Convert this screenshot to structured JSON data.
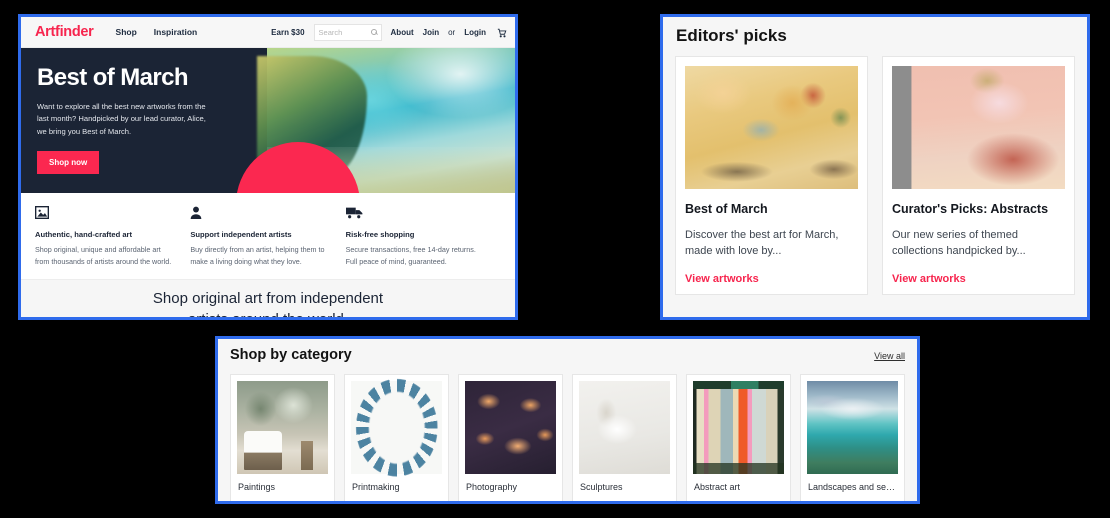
{
  "theme": {
    "accent_red": "#f7254e",
    "hero_bg": "#1b2435",
    "panel_border_blue": "#2f6bec",
    "page_bg": "#000000"
  },
  "homepage": {
    "header": {
      "brand": "Artfinder",
      "nav": [
        {
          "label": "Shop",
          "name": "nav-shop"
        },
        {
          "label": "Inspiration",
          "name": "nav-inspiration"
        }
      ],
      "earn_label": "Earn $30",
      "search_placeholder": "Search",
      "search_value": "",
      "about_label": "About",
      "join_label": "Join",
      "or_label": "or",
      "login_label": "Login",
      "cart_icon": "shopping-cart-icon",
      "search_icon": "search-icon"
    },
    "hero": {
      "title": "Best of March",
      "subtitle": "Want to explore all the best new artworks from the last month? Handpicked by our lead curator, Alice, we bring you Best of March.",
      "cta_label": "Shop now"
    },
    "features": [
      {
        "icon": "image-icon",
        "title": "Authentic, hand-crafted art",
        "text": "Shop original, unique and affordable art from thousands of artists around the world."
      },
      {
        "icon": "person-icon",
        "title": "Support independent artists",
        "text": "Buy directly from an artist, helping them to make a living doing what they love."
      },
      {
        "icon": "truck-icon",
        "title": "Risk-free shopping",
        "text": "Secure transactions, free 14-day returns. Full peace of mind, guaranteed."
      }
    ],
    "tagline": "Shop original art from independent artists around the world."
  },
  "editors_picks": {
    "title": "Editors' picks",
    "cards": [
      {
        "image": "best-of-march-artwork",
        "name": "Best of March",
        "description": "Discover the best art for March, made with love by...",
        "link_label": "View artworks"
      },
      {
        "image": "curators-picks-abstracts-artwork",
        "name": "Curator's Picks: Abstracts",
        "description": "Our new series of themed collections handpicked by...",
        "link_label": "View artworks"
      }
    ]
  },
  "shop_by_category": {
    "title": "Shop by category",
    "view_all_label": "View all",
    "categories": [
      {
        "label": "Paintings",
        "image": "paintings-thumbnail"
      },
      {
        "label": "Printmaking",
        "image": "printmaking-thumbnail"
      },
      {
        "label": "Photography",
        "image": "photography-thumbnail"
      },
      {
        "label": "Sculptures",
        "image": "sculptures-thumbnail"
      },
      {
        "label": "Abstract art",
        "image": "abstract-art-thumbnail"
      },
      {
        "label": "Landscapes and se…",
        "image": "landscapes-thumbnail"
      }
    ]
  }
}
